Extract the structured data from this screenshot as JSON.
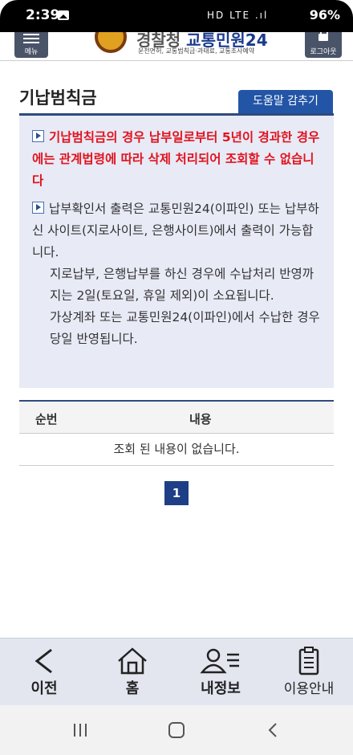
{
  "status_bar": {
    "time": "2:39",
    "indicators": "HD LTE .ıl",
    "battery": "96%",
    "icons": [
      "gallery-icon",
      "battery-saver-icon",
      "alarm-icon",
      "hotspot-icon",
      "signal-icon",
      "battery-icon"
    ]
  },
  "header": {
    "menu_label": "메뉴",
    "logo_title_prefix": "경찰청",
    "logo_title_main": "교통민원24",
    "logo_subtitle": "운전면허, 교통범칙금·과태료, 교통조사예약",
    "logout_label": "로그아웃"
  },
  "page": {
    "title": "기납범칙금",
    "help_button": "도움말 감추기",
    "notice_warning": "기납범칙금의 경우 납부일로부터 5년이 경과한 경우에는 관계법령에 따라 삭제 처리되어 조회할 수 없습니다",
    "notice_1": "납부확인서 출력은 교통민원24(이파인) 또는 납부하신 사이트(지로사이트, 은행사이트)에서 출력이 가능합니다.",
    "notice_2": "지로납부, 은행납부를 하신 경우에 수납처리 반영까지는 2일(토요일, 휴일 제외)이 소요됩니다.",
    "notice_3": "가상계좌 또는 교통민원24(이파인)에서 수납한 경우 당일 반영됩니다."
  },
  "table": {
    "columns": [
      "순번",
      "내용"
    ],
    "empty_message": "조회 된 내용이 없습니다."
  },
  "pagination": {
    "current_page": "1"
  },
  "bottom_nav": {
    "items": [
      {
        "label": "이전",
        "icon": "back-arrow-icon"
      },
      {
        "label": "홈",
        "icon": "home-icon"
      },
      {
        "label": "내정보",
        "icon": "my-info-icon"
      },
      {
        "label": "이용안내",
        "icon": "guide-icon"
      }
    ]
  },
  "colors": {
    "accent": "#2355a7",
    "warning": "#e0141e",
    "notice_bg": "#e8eaf6",
    "bottom_nav_bg": "#e3e6ef"
  }
}
